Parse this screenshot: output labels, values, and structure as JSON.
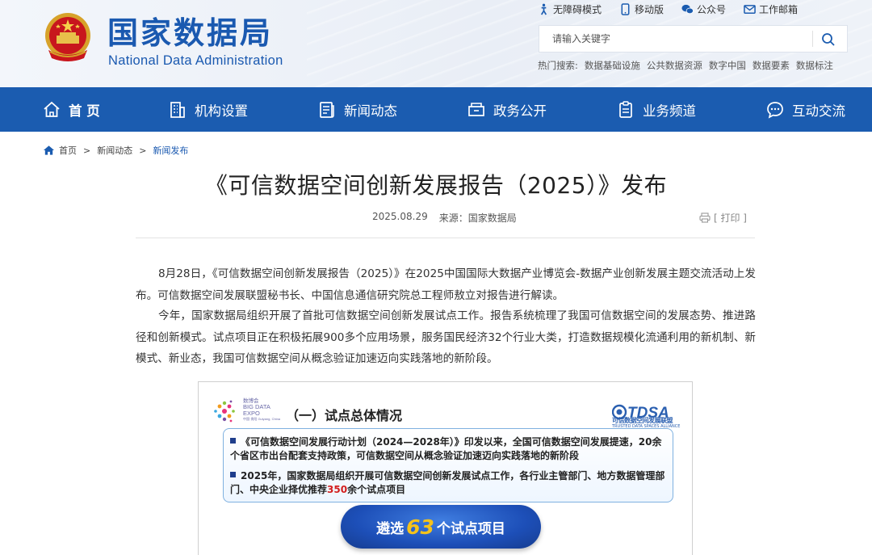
{
  "header": {
    "logo_cn": "国家数据局",
    "logo_en": "National Data Administration",
    "top_links": [
      {
        "label": "无障碍模式",
        "icon": "accessibility-icon"
      },
      {
        "label": "移动版",
        "icon": "mobile-icon"
      },
      {
        "label": "公众号",
        "icon": "wechat-icon"
      },
      {
        "label": "工作邮箱",
        "icon": "mail-icon"
      }
    ],
    "search": {
      "placeholder": "请输入关键字"
    },
    "hot_label": "热门搜索:",
    "hot_keywords": [
      "数据基础设施",
      "公共数据资源",
      "数字中国",
      "数据要素",
      "数据标注"
    ]
  },
  "nav": {
    "items": [
      {
        "label": "首 页",
        "icon": "home-icon"
      },
      {
        "label": "机构设置",
        "icon": "building-icon"
      },
      {
        "label": "新闻动态",
        "icon": "news-icon"
      },
      {
        "label": "政务公开",
        "icon": "folder-icon"
      },
      {
        "label": "业务频道",
        "icon": "clipboard-icon"
      },
      {
        "label": "互动交流",
        "icon": "chat-icon"
      }
    ]
  },
  "breadcrumb": {
    "items": [
      "首页",
      "新闻动态",
      "新闻发布"
    ],
    "separator": ">"
  },
  "article": {
    "title": "《可信数据空间创新发展报告（2025）》发布",
    "date": "2025.08.29",
    "source": "来源：国家数据局",
    "print_label": "[ 打印 ]",
    "paragraphs": [
      "8月28日，《可信数据空间创新发展报告（2025）》在2025中国国际大数据产业博览会-数据产业创新发展主题交流活动上发布。可信数据空间发展联盟秘书长、中国信息通信研究院总工程师敖立对报告进行解读。",
      "今年，国家数据局组织开展了首批可信数据空间创新发展试点工作。报告系统梳理了我国可信数据空间的发展态势、推进路径和创新模式。试点项目正在积极拓展900多个应用场景，服务国民经济32个行业大类，打造数据规模化流通利用的新机制、新模式、新业态，我国可信数据空间从概念验证加速迈向实践落地的新阶段。"
    ]
  },
  "slide": {
    "expo_cn": "数博会",
    "expo_en1": "BIG DATA",
    "expo_en2": "EXPO",
    "expo_en3": "中国·贵阳  Guiyang, China",
    "section_title": "（一）试点总体情况",
    "alliance_logo": "TDSA",
    "alliance_cn": "可信数据空间发展联盟",
    "alliance_en": "TRUSTED DATA SPACES ALLIANCE",
    "bullet1": "《可信数据空间发展行动计划（2024—2028年）》印发以来，全国可信数据空间发展提速，20余个省区市出台配套支持政策，可信数据空间从概念验证加速迈向实践落地的新阶段",
    "bullet2_pre": "2025年，国家数据局组织开展可信数据空间创新发展试点工作，各行业主管部门、地方数据管理部门、中央企业择优推荐",
    "bullet2_num": "350",
    "bullet2_post": "余个试点项目",
    "pill_pre": "遴选",
    "pill_num": "63",
    "pill_post": "个试点项目"
  },
  "colors": {
    "brand_blue": "#1b5cb0",
    "logo_blue": "#1a59b0",
    "highlight_red": "#d21e1e",
    "pill_yellow": "#f5c21b"
  }
}
